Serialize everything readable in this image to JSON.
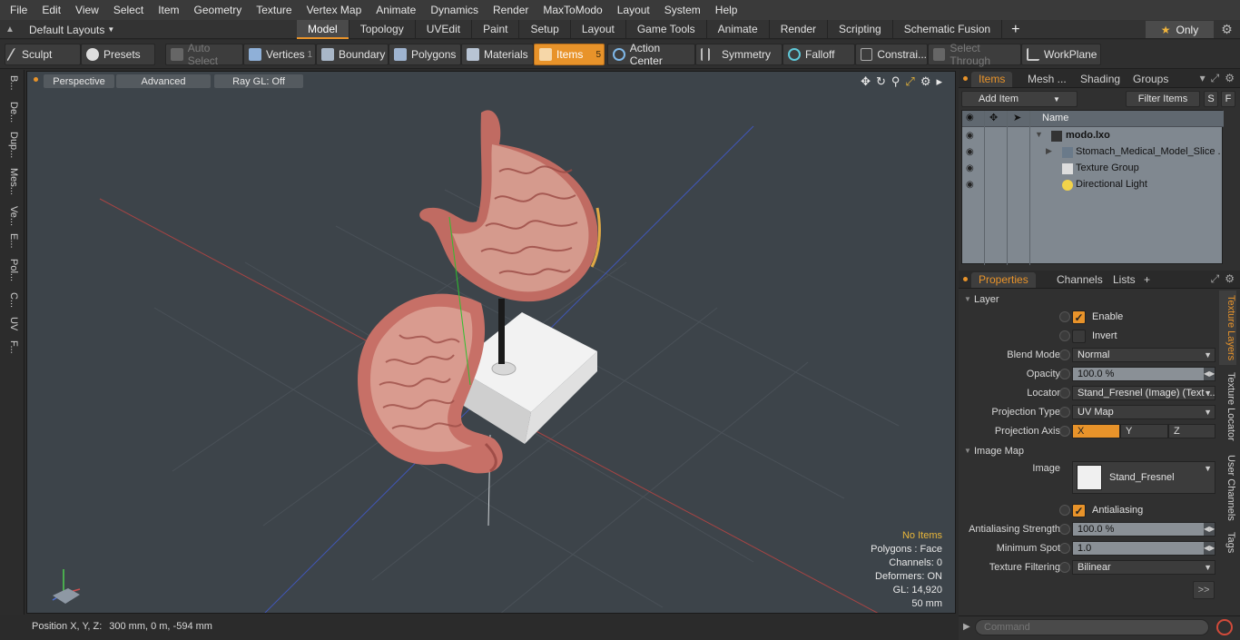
{
  "menu": [
    "File",
    "Edit",
    "View",
    "Select",
    "Item",
    "Geometry",
    "Texture",
    "Vertex Map",
    "Animate",
    "Dynamics",
    "Render",
    "MaxToModo",
    "Layout",
    "System",
    "Help"
  ],
  "layout": {
    "selector": "Default Layouts",
    "only_label": "Only"
  },
  "tabs": [
    {
      "label": "Model",
      "active": true
    },
    {
      "label": "Topology"
    },
    {
      "label": "UVEdit"
    },
    {
      "label": "Paint"
    },
    {
      "label": "Setup"
    },
    {
      "label": "Layout"
    },
    {
      "label": "Game Tools"
    },
    {
      "label": "Animate"
    },
    {
      "label": "Render"
    },
    {
      "label": "Scripting"
    },
    {
      "label": "Schematic Fusion"
    }
  ],
  "toolbar": {
    "sculpt": "Sculpt",
    "presets": "Presets",
    "auto_select": "Auto Select",
    "vertices": "Vertices",
    "vertices_count": "1",
    "boundary": "Boundary",
    "polygons": "Polygons",
    "materials": "Materials",
    "items": "Items",
    "items_count": "5",
    "action_center": "Action Center",
    "symmetry": "Symmetry",
    "falloff": "Falloff",
    "constraints": "Constrai...",
    "select_through": "Select Through",
    "workplane": "WorkPlane"
  },
  "left_strip": [
    "B...",
    "De...",
    "Dup...",
    "Mes...",
    "Ve...",
    "E...",
    "Pol...",
    "C...",
    "UV",
    "F..."
  ],
  "viewport": {
    "view": "Perspective",
    "shading": "Advanced",
    "raygl": "Ray GL: Off",
    "stats": {
      "no_items": "No Items",
      "polygons": "Polygons : Face",
      "channels": "Channels: 0",
      "deformers": "Deformers: ON",
      "gl": "GL: 14,920",
      "scale": "50 mm"
    }
  },
  "status": {
    "label": "Position X, Y, Z:",
    "value": "300 mm, 0 m, -594 mm"
  },
  "items_panel": {
    "tabs": [
      "Items",
      "Mesh ...",
      "Shading",
      "Groups"
    ],
    "add_item": "Add Item",
    "filter": "Filter Items",
    "s_btn": "S",
    "f_btn": "F",
    "name_col": "Name",
    "rows": [
      {
        "name": "modo.lxo",
        "bold": true
      },
      {
        "name": "Stomach_Medical_Model_Slice ..."
      },
      {
        "name": "Texture Group"
      },
      {
        "name": "Directional Light"
      }
    ]
  },
  "properties": {
    "tabs": [
      "Properties",
      "Channels",
      "Lists"
    ],
    "layer_section": "Layer",
    "enable": "Enable",
    "invert": "Invert",
    "blend_mode_label": "Blend Mode",
    "blend_mode": "Normal",
    "opacity_label": "Opacity",
    "opacity": "100.0 %",
    "locator_label": "Locator",
    "locator": "Stand_Fresnel (Image) (Text ...",
    "projection_type_label": "Projection Type",
    "projection_type": "UV Map",
    "projection_axis_label": "Projection Axis",
    "axis_x": "X",
    "axis_y": "Y",
    "axis_z": "Z",
    "image_map_section": "Image Map",
    "image_label": "Image",
    "image": "Stand_Fresnel",
    "antialiasing": "Antialiasing",
    "aa_strength_label": "Antialiasing Strength",
    "aa_strength": "100.0 %",
    "min_spot_label": "Minimum Spot",
    "min_spot": "1.0",
    "tex_filter_label": "Texture Filtering",
    "tex_filter": "Bilinear",
    "more": ">>",
    "side_tabs": [
      "Texture Layers",
      "Texture Locator",
      "User Channels",
      "Tags"
    ]
  },
  "command": {
    "placeholder": "Command"
  },
  "colors": {
    "accent": "#e8932a",
    "viewport_bg": "#3d444a"
  }
}
